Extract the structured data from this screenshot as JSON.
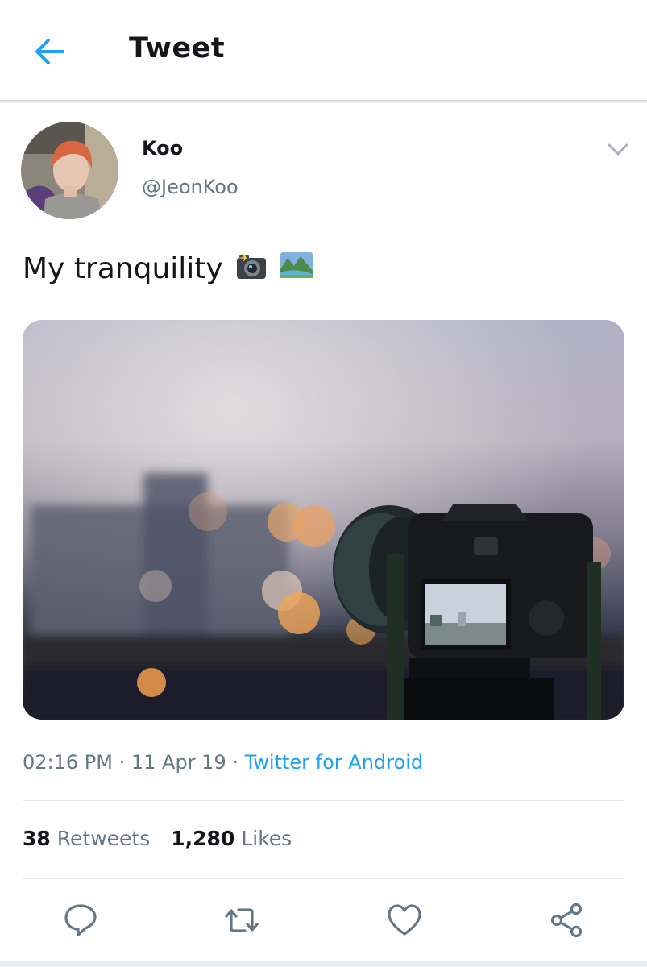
{
  "header": {
    "title": "Tweet",
    "back_icon": "arrow-left-icon",
    "accent": "#1da1f2"
  },
  "author": {
    "name": "Koo",
    "handle": "@JeonKoo",
    "menu_icon": "chevron-down-icon"
  },
  "tweet": {
    "text": "My tranquility",
    "emojis": [
      "camera-flash-emoji",
      "national-park-emoji"
    ],
    "timestamp": "02:16 PM · 11 Apr 19 · ",
    "source": "Twitter for Android"
  },
  "stats": {
    "retweets_count": "38",
    "retweets_label": "Retweets",
    "likes_count": "1,280",
    "likes_label": "Likes"
  },
  "actions": [
    "reply-icon",
    "retweet-icon",
    "like-icon",
    "share-icon"
  ],
  "colors": {
    "text": "#14171a",
    "secondary": "#657786",
    "divider": "#e1e8ed"
  }
}
